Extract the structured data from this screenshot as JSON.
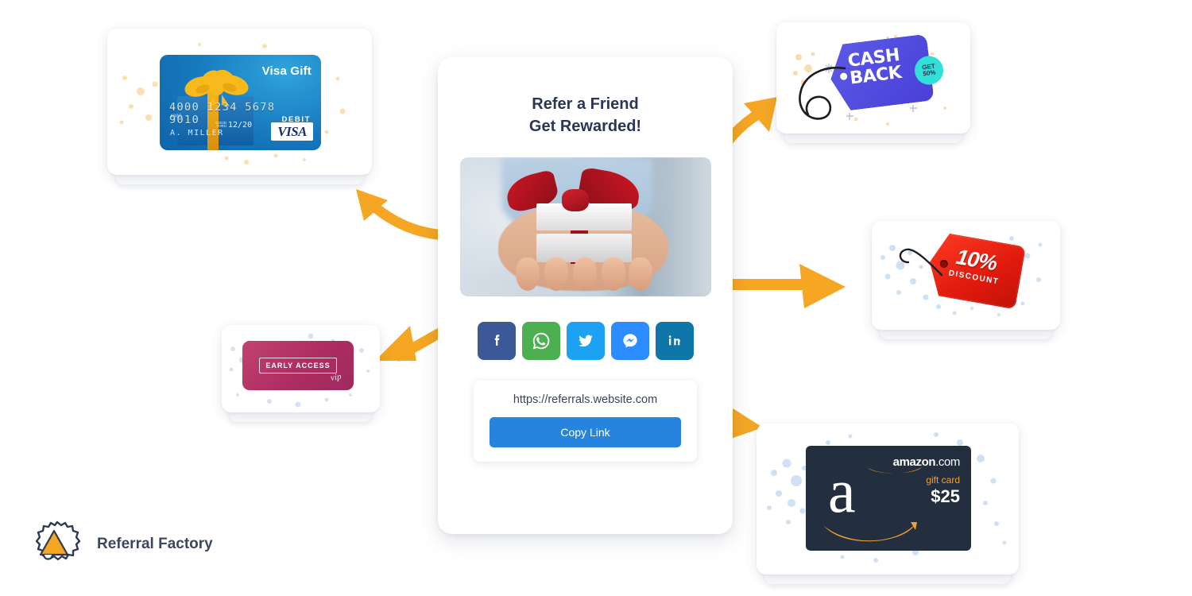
{
  "brand": {
    "name": "Referral Factory",
    "logo_icon": "megaphone-starburst-icon",
    "accent": "#F5A623"
  },
  "widget": {
    "title_line1": "Refer a Friend",
    "title_line2": "Get Rewarded!",
    "hero_image_alt": "hands-holding-gift-box",
    "referral_url": "https://referrals.website.com",
    "copy_button_label": "Copy Link",
    "copy_button_color": "#2684DE",
    "social_buttons": [
      {
        "name": "facebook",
        "label": "f",
        "color": "#3B5998"
      },
      {
        "name": "whatsapp",
        "label": "WhatsApp",
        "color": "#4CAF50"
      },
      {
        "name": "twitter",
        "label": "Twitter",
        "color": "#1DA1F2"
      },
      {
        "name": "messenger",
        "label": "Messenger",
        "color": "#2D8CFF"
      },
      {
        "name": "linkedin",
        "label": "in",
        "color": "#0E76A8"
      }
    ]
  },
  "rewards": {
    "visa": {
      "title": "Visa Gift",
      "number": "4000 1234 5678 9010",
      "small_number": "4000",
      "debit": "DEBIT",
      "good_thru_label": "GOOD THRU",
      "expiry": "12/20",
      "holder": "A. MILLER",
      "logo": "VISA"
    },
    "early_access": {
      "label": "EARLY ACCESS",
      "sub": "vip"
    },
    "cash_back": {
      "line1": "CASH",
      "line2": "BACK",
      "badge_line1": "GET",
      "badge_line2": "50%",
      "tag_color": "#4F46E5",
      "badge_color": "#31E0D6"
    },
    "discount": {
      "percent": "10%",
      "label": "DISCOUNT",
      "tag_color": "#E01A0C"
    },
    "amazon": {
      "brand_bold": "amazon",
      "brand_light": ".com",
      "gift_card": "gift card",
      "amount": "$25",
      "card_color": "#232F3E",
      "accent": "#F0A030"
    }
  },
  "arrows": {
    "color": "#F5A623",
    "items": [
      {
        "name": "arrow-to-visa",
        "direction": "up-left"
      },
      {
        "name": "arrow-to-cashback",
        "direction": "up-right"
      },
      {
        "name": "arrow-to-discount",
        "direction": "right"
      },
      {
        "name": "arrow-to-amazon",
        "direction": "down-right"
      },
      {
        "name": "arrow-to-early-access",
        "direction": "down-left"
      }
    ]
  }
}
